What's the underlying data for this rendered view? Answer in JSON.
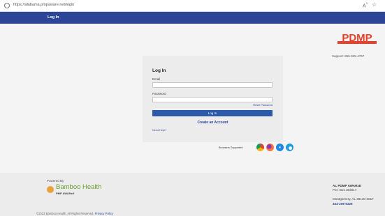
{
  "browser": {
    "url": "https://alabama.pmpaware.net/login"
  },
  "nav": {
    "login_link": "Log In"
  },
  "brand": {
    "logo_text": "PDMP",
    "support": "Support: 855-925-4767",
    "accent_color": "#e8402a",
    "nav_color": "#2c4596"
  },
  "login": {
    "title": "Log In",
    "email_label": "Email",
    "email_value": "",
    "password_label": "Password",
    "password_value": "",
    "reset_password": "Reset Password",
    "submit_label": "Log In",
    "create_account": "Create an Account",
    "need_help": "Need Help?"
  },
  "browsers": {
    "label": "Browsers Supported",
    "icons": [
      "chrome-icon",
      "firefox-icon",
      "safari-icon",
      "edge-icon"
    ]
  },
  "footer": {
    "powered_by": "Powered By",
    "vendor_name": "Bamboo Health",
    "vendor_product": "PMP AWARxE",
    "copyright": "©2023 Bamboo Health. All Rights Reserved.",
    "privacy_policy": "Privacy Policy",
    "org_name": "AL PDMP AWARxE",
    "po_box": "P.O. Box 303017",
    "city": "Montgomery, AL 36130-3017",
    "phone": "334-206-5226"
  }
}
